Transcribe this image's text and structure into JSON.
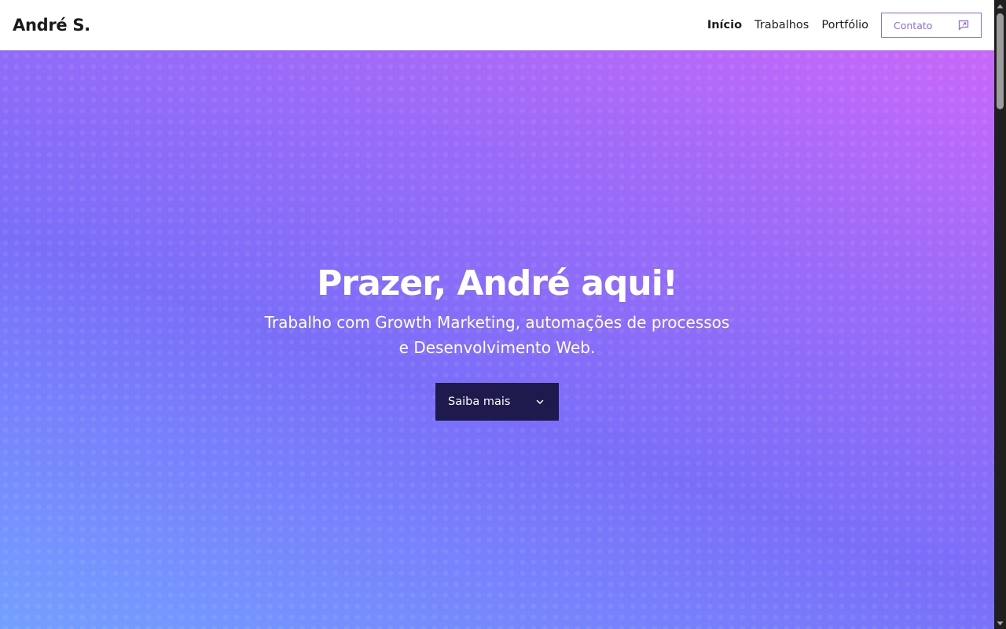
{
  "header": {
    "brand": "André S.",
    "nav": [
      {
        "label": "Início",
        "active": true
      },
      {
        "label": "Trabalhos",
        "active": false
      },
      {
        "label": "Portfólio",
        "active": false
      }
    ],
    "contact_label": "Contato",
    "contact_icon": "chat-icon"
  },
  "hero": {
    "title": "Prazer, André aqui!",
    "subtitle_line1": "Trabalho com Growth Marketing, automações de processos",
    "subtitle_line2": "e Desenvolvimento Web.",
    "cta_label": "Saiba mais",
    "cta_icon": "chevron-down-icon"
  },
  "colors": {
    "accent": "#8d6cf0",
    "cta_background": "#1f1a4d",
    "gradient_start": "#73a0ff",
    "gradient_mid": "#7a6ef9",
    "gradient_end": "#c868f9"
  },
  "scrollbar": {
    "up_icon": "scroll-up-arrow",
    "down_icon": "scroll-down-arrow"
  }
}
